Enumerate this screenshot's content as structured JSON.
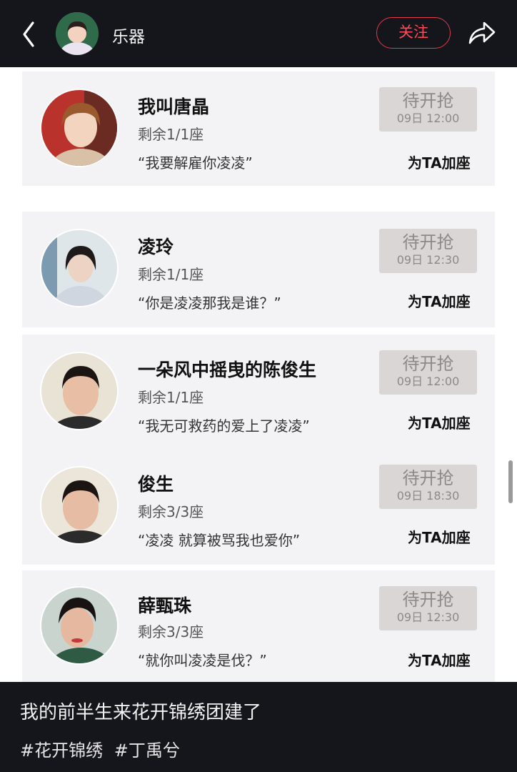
{
  "header": {
    "title": "乐器",
    "follow_label": "关注"
  },
  "rows": [
    {
      "name": "我叫唐晶",
      "seats": "剩余1/1座",
      "quote": "“我要解雇你凌凌”",
      "grab_label": "待开抢",
      "grab_time": "09日 12:00",
      "add_label": "为TA加座"
    },
    {
      "name": "凌玲",
      "seats": "剩余1/1座",
      "quote": "“你是凌凌那我是谁？”",
      "grab_label": "待开抢",
      "grab_time": "09日 12:30",
      "add_label": "为TA加座"
    },
    {
      "name": "一朵风中摇曳的陈俊生",
      "seats": "剩余1/1座",
      "quote": "“我无可救药的爱上了凌凌”",
      "grab_label": "待开抢",
      "grab_time": "09日 12:00",
      "add_label": "为TA加座"
    },
    {
      "name": "俊生",
      "seats": "剩余3/3座",
      "quote": "“凌凌 就算被骂我也爱你”",
      "grab_label": "待开抢",
      "grab_time": "09日 18:30",
      "add_label": "为TA加座"
    },
    {
      "name": "薛甄珠",
      "seats": "剩余3/3座",
      "quote": "“就你叫凌凌是伐？”",
      "grab_label": "待开抢",
      "grab_time": "09日 12:30",
      "add_label": "为TA加座"
    }
  ],
  "caption": {
    "title": "我的前半生来花开锦绣团建了",
    "tags": [
      "#花开锦绣",
      "#丁禹兮"
    ]
  },
  "colors": {
    "header_bg": "#15151c",
    "accent": "#e63a46",
    "card_bg": "#f3f3f5",
    "grab_bg": "#d9d6d5"
  },
  "icons": [
    "chevron-left-icon",
    "share-arrow-icon"
  ]
}
